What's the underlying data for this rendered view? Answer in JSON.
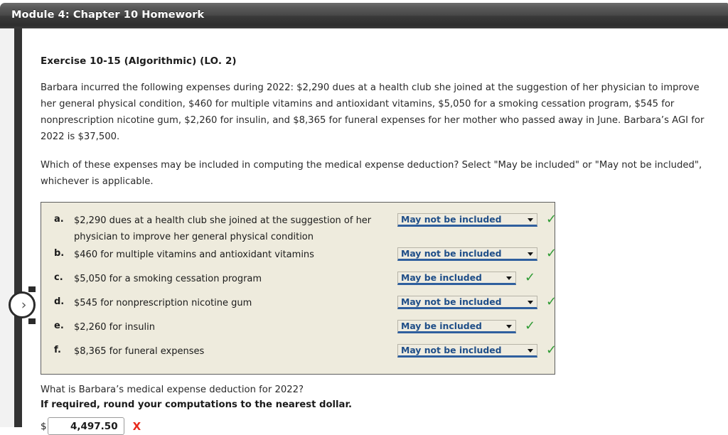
{
  "window": {
    "title": "Module 4: Chapter 10 Homework"
  },
  "nav": {
    "next_handle_icon": "chevron-right-icon",
    "next_handle_label": "›"
  },
  "exercise": {
    "title": "Exercise 10-15 (Algorithmic) (LO. 2)",
    "paragraph_1": "Barbara incurred the following expenses during 2022: $2,290 dues at a health club she joined at the suggestion of her physician to improve her general physical condition, $460 for multiple vitamins and antioxidant vitamins, $5,050 for a smoking cessation program, $545 for nonprescription nicotine gum, $2,260 for insulin, and $8,365 for funeral expenses for her mother who passed away in June. Barbara’s AGI for 2022 is $37,500.",
    "paragraph_2": "Which of these expenses may be included in computing the medical expense deduction? Select \"May be included\" or \"May not be included\", whichever is applicable."
  },
  "answer_panel": {
    "rows": [
      {
        "letter": "a.",
        "text": "$2,290 dues at a health club she joined at the suggestion of her physician to improve her general physical condition",
        "selected": "May not be included",
        "status_icon": "check-icon",
        "status_mark": "✓"
      },
      {
        "letter": "b.",
        "text": "$460 for multiple vitamins and antioxidant vitamins",
        "selected": "May not be included",
        "status_icon": "check-icon",
        "status_mark": "✓"
      },
      {
        "letter": "c.",
        "text": "$5,050 for a smoking cessation program",
        "selected": "May be included",
        "status_icon": "check-icon",
        "status_mark": "✓"
      },
      {
        "letter": "d.",
        "text": "$545 for nonprescription nicotine gum",
        "selected": "May not be included",
        "status_icon": "check-icon",
        "status_mark": "✓"
      },
      {
        "letter": "e.",
        "text": "$2,260 for insulin",
        "selected": "May be included",
        "status_icon": "check-icon",
        "status_mark": "✓"
      },
      {
        "letter": "f.",
        "text": "$8,365 for funeral expenses",
        "selected": "May not be included",
        "status_icon": "check-icon",
        "status_mark": "✓"
      }
    ],
    "options": [
      "May be included",
      "May not be included"
    ]
  },
  "final_question": {
    "prompt": "What is Barbara’s medical expense deduction for 2022?",
    "instruction": "If required, round your computations to the nearest dollar.",
    "currency_symbol": "$",
    "answer_value": "4,497.50",
    "status_icon": "x-icon",
    "status_mark": "X"
  },
  "colors": {
    "titlebar_dark": "#3a3a3a",
    "panel_background": "#eeebdd",
    "select_text": "#1f4e88",
    "select_underline": "#2f5f9e",
    "correct_green": "#2f9b34",
    "incorrect_red": "#e8291c"
  }
}
